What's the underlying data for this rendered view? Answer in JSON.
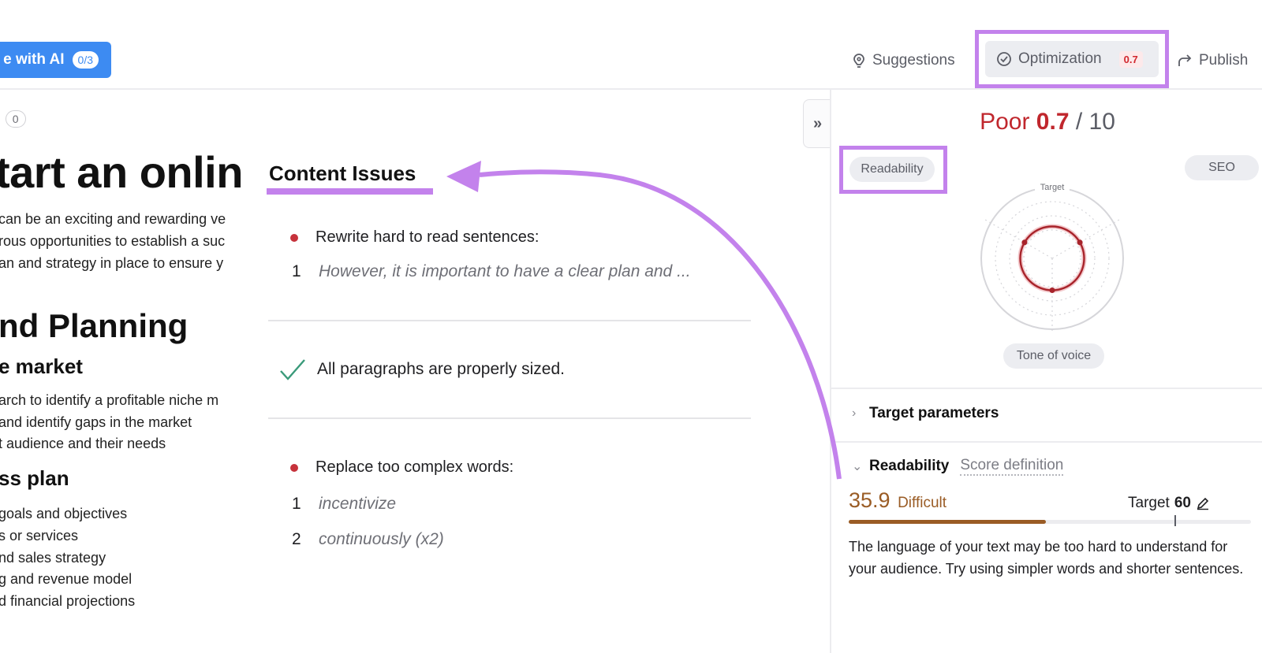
{
  "topbar": {
    "ai_button": {
      "label": "e with AI",
      "badge": "0/3"
    },
    "nav": {
      "suggestions": "Suggestions",
      "optimization": "Optimization",
      "optimization_badge": "0.7",
      "publish": "Publish"
    }
  },
  "document": {
    "counter_prefix": ":",
    "counter_value": "0",
    "title": "tart an onlin",
    "intro_lines": [
      "can be an exciting and rewarding ve",
      "rous opportunities to establish a suc",
      "an and strategy in place to ensure y"
    ],
    "section_heading": "nd Planning",
    "subheading_1": "e market",
    "market_lines": [
      "arch to identify a profitable niche m",
      "and identify gaps in the market",
      "t audience and their needs"
    ],
    "subheading_2": "ss plan",
    "plan_lines": [
      "goals and objectives",
      "s or services",
      "nd sales strategy",
      "g and revenue model",
      "d financial projections"
    ]
  },
  "content_issues": {
    "title": "Content Issues",
    "groups": [
      {
        "status": "error",
        "label": "Rewrite hard to read sentences:",
        "items": [
          {
            "num": "1",
            "text": "However, it is important to have a clear plan and ..."
          }
        ]
      },
      {
        "status": "ok",
        "label": "All paragraphs are properly sized."
      },
      {
        "status": "error",
        "label": "Replace too complex words:",
        "items": [
          {
            "num": "1",
            "text": "incentivize"
          },
          {
            "num": "2",
            "text": "continuously (x2)"
          }
        ]
      }
    ]
  },
  "panel": {
    "collapse_label": "»",
    "score": {
      "rating": "Poor",
      "value": "0.7",
      "max": "/ 10"
    },
    "radar": {
      "axes": [
        "Readability",
        "SEO",
        "Tone of voice"
      ],
      "target_label": "Target",
      "values": [
        0.45,
        0.45,
        0.45
      ],
      "target": 1.0
    },
    "target_parameters": "Target parameters",
    "readability_section": {
      "title": "Readability",
      "link": "Score definition",
      "score": "35.9",
      "score_label": "Difficult",
      "target_label": "Target",
      "target_value": "60",
      "progress_percent": 49,
      "target_percent": 81,
      "description": "The language of your text may be too hard to understand for your audience. Try using simpler words and shorter sentences."
    }
  },
  "colors": {
    "accent_purple": "#c382ec",
    "ai_blue": "#3d8bf2",
    "error_red": "#c0272d",
    "difficult_brown": "#9a5c25",
    "ok_green": "#3a9a7a"
  }
}
